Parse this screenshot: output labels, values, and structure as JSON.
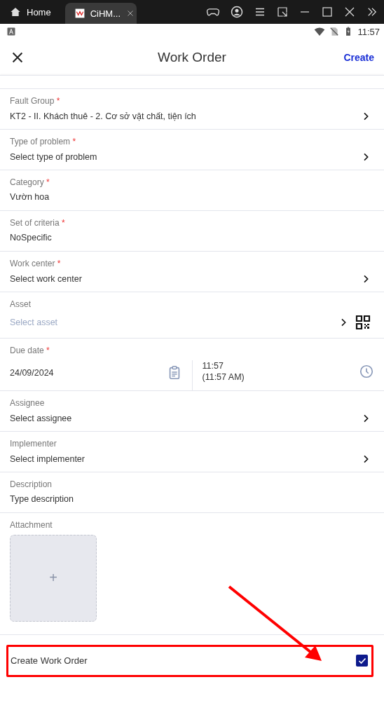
{
  "window": {
    "tabs": [
      {
        "label": "Home",
        "selected": false,
        "kind": "home"
      },
      {
        "label": "CiHM...",
        "selected": true,
        "kind": "app"
      }
    ]
  },
  "status_bar": {
    "time": "11:57"
  },
  "header": {
    "title": "Work Order",
    "action": "Create"
  },
  "fields": [
    {
      "kind": "select",
      "label": "Fault Group",
      "required_mark": "*",
      "value": "KT2 - II. Khách thuê - 2. Cơ sở vật chất, tiện ích",
      "disabled": false
    },
    {
      "kind": "select",
      "label": "Type of problem",
      "required_mark": "*",
      "value": "Select type of problem",
      "disabled": false
    },
    {
      "kind": "text",
      "label": "Category",
      "required_mark": "*",
      "value": "Vườn hoa",
      "disabled": false
    },
    {
      "kind": "text",
      "label": "Set of criteria",
      "required_mark": "*",
      "value": "NoSpecific",
      "disabled": false
    },
    {
      "kind": "select",
      "label": "Work center",
      "required_mark": "*",
      "value": "Select work center",
      "disabled": false
    },
    {
      "kind": "asset",
      "label": "Asset",
      "value": "Select asset",
      "disabled": true
    },
    {
      "kind": "datetime",
      "label": "Due date",
      "required_mark": "*",
      "date": "24/09/2024",
      "time": "11:57",
      "time_12h": "(11:57 AM)"
    },
    {
      "kind": "select",
      "label": "Assignee",
      "value": "Select assignee",
      "disabled": false
    },
    {
      "kind": "select",
      "label": "Implementer",
      "value": "Select implementer",
      "disabled": false
    },
    {
      "kind": "text",
      "label": "Description",
      "value": "Type description",
      "disabled": false
    },
    {
      "kind": "attachment",
      "label": "Attachment",
      "add": "+"
    }
  ],
  "create_work_order": {
    "label": "Create Work Order",
    "checked": true
  }
}
